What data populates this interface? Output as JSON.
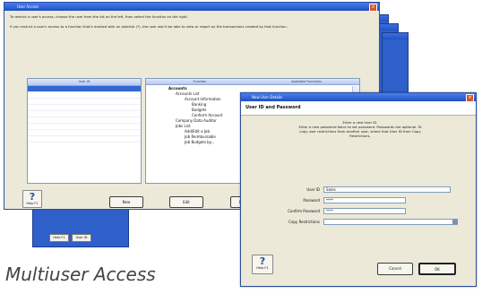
{
  "main_window": {
    "title": "User Access",
    "instruction1": "To restrict a user's access, choose the user from the list on the left, then select the function on the right.",
    "instruction2": "If you restrict a user's access to a function that's marked with an asterisk (*), the user won't be able to view or report on the transactions created by that function.",
    "columns": {
      "user": "User ID",
      "function": "Function",
      "access": "Available Functions"
    },
    "tree": [
      "Accounts",
      "Accounts List",
      "Account Information",
      "Banking",
      "Budgets",
      "Conform Account",
      "Company Data Auditor",
      "Jobs List",
      "Add/Edit a Job",
      "Job Reimbursable",
      "Job Budgets by..."
    ],
    "buttons": {
      "new": "New",
      "edit": "Edit",
      "delete": "Del"
    },
    "help": {
      "icon": "?",
      "label": "Help F1"
    }
  },
  "back_window": {
    "buttons": [
      "Help F1",
      "User ID"
    ]
  },
  "dialog": {
    "title": "New User Details",
    "header": "User ID and Password",
    "instructions": [
      "Enter a new User ID.",
      "Enter a new password twice to set password. Passwords are optional. To",
      "copy user restrictions from another user, select that User ID from Copy",
      "Restrictions."
    ],
    "fields": {
      "user_id_label": "User ID",
      "user_id_value": "Sales",
      "password_label": "Password",
      "password_value": "****",
      "confirm_label": "Confirm Password",
      "confirm_value": "****",
      "copy_label": "Copy Restrictions",
      "copy_value": ""
    },
    "buttons": {
      "cancel": "Cancel",
      "ok": "OK"
    },
    "help": {
      "icon": "?",
      "label": "Help F1"
    }
  },
  "caption": "Multiuser Access"
}
